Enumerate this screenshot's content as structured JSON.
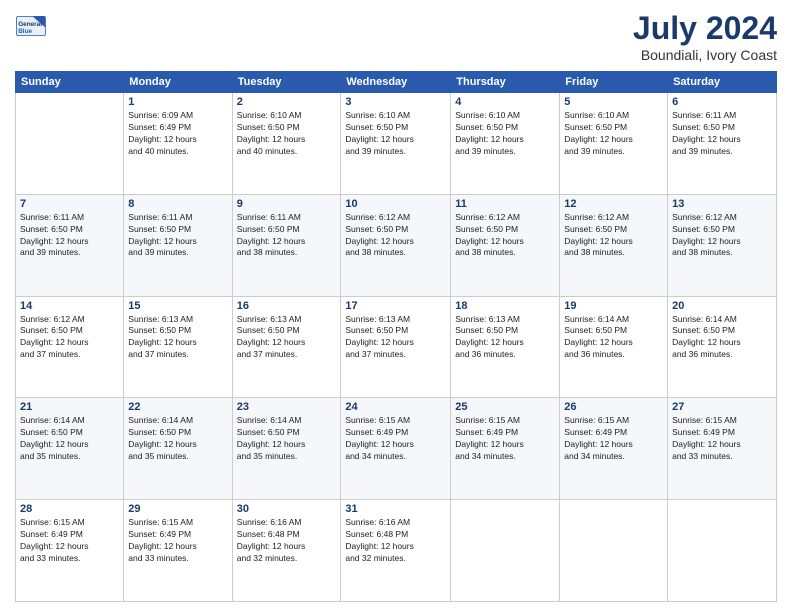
{
  "logo": {
    "line1": "General",
    "line2": "Blue"
  },
  "title": "July 2024",
  "subtitle": "Boundiali, Ivory Coast",
  "header_days": [
    "Sunday",
    "Monday",
    "Tuesday",
    "Wednesday",
    "Thursday",
    "Friday",
    "Saturday"
  ],
  "weeks": [
    [
      {
        "day": "",
        "info": ""
      },
      {
        "day": "1",
        "info": "Sunrise: 6:09 AM\nSunset: 6:49 PM\nDaylight: 12 hours\nand 40 minutes."
      },
      {
        "day": "2",
        "info": "Sunrise: 6:10 AM\nSunset: 6:50 PM\nDaylight: 12 hours\nand 40 minutes."
      },
      {
        "day": "3",
        "info": "Sunrise: 6:10 AM\nSunset: 6:50 PM\nDaylight: 12 hours\nand 39 minutes."
      },
      {
        "day": "4",
        "info": "Sunrise: 6:10 AM\nSunset: 6:50 PM\nDaylight: 12 hours\nand 39 minutes."
      },
      {
        "day": "5",
        "info": "Sunrise: 6:10 AM\nSunset: 6:50 PM\nDaylight: 12 hours\nand 39 minutes."
      },
      {
        "day": "6",
        "info": "Sunrise: 6:11 AM\nSunset: 6:50 PM\nDaylight: 12 hours\nand 39 minutes."
      }
    ],
    [
      {
        "day": "7",
        "info": "Sunrise: 6:11 AM\nSunset: 6:50 PM\nDaylight: 12 hours\nand 39 minutes."
      },
      {
        "day": "8",
        "info": "Sunrise: 6:11 AM\nSunset: 6:50 PM\nDaylight: 12 hours\nand 39 minutes."
      },
      {
        "day": "9",
        "info": "Sunrise: 6:11 AM\nSunset: 6:50 PM\nDaylight: 12 hours\nand 38 minutes."
      },
      {
        "day": "10",
        "info": "Sunrise: 6:12 AM\nSunset: 6:50 PM\nDaylight: 12 hours\nand 38 minutes."
      },
      {
        "day": "11",
        "info": "Sunrise: 6:12 AM\nSunset: 6:50 PM\nDaylight: 12 hours\nand 38 minutes."
      },
      {
        "day": "12",
        "info": "Sunrise: 6:12 AM\nSunset: 6:50 PM\nDaylight: 12 hours\nand 38 minutes."
      },
      {
        "day": "13",
        "info": "Sunrise: 6:12 AM\nSunset: 6:50 PM\nDaylight: 12 hours\nand 38 minutes."
      }
    ],
    [
      {
        "day": "14",
        "info": "Sunrise: 6:12 AM\nSunset: 6:50 PM\nDaylight: 12 hours\nand 37 minutes."
      },
      {
        "day": "15",
        "info": "Sunrise: 6:13 AM\nSunset: 6:50 PM\nDaylight: 12 hours\nand 37 minutes."
      },
      {
        "day": "16",
        "info": "Sunrise: 6:13 AM\nSunset: 6:50 PM\nDaylight: 12 hours\nand 37 minutes."
      },
      {
        "day": "17",
        "info": "Sunrise: 6:13 AM\nSunset: 6:50 PM\nDaylight: 12 hours\nand 37 minutes."
      },
      {
        "day": "18",
        "info": "Sunrise: 6:13 AM\nSunset: 6:50 PM\nDaylight: 12 hours\nand 36 minutes."
      },
      {
        "day": "19",
        "info": "Sunrise: 6:14 AM\nSunset: 6:50 PM\nDaylight: 12 hours\nand 36 minutes."
      },
      {
        "day": "20",
        "info": "Sunrise: 6:14 AM\nSunset: 6:50 PM\nDaylight: 12 hours\nand 36 minutes."
      }
    ],
    [
      {
        "day": "21",
        "info": "Sunrise: 6:14 AM\nSunset: 6:50 PM\nDaylight: 12 hours\nand 35 minutes."
      },
      {
        "day": "22",
        "info": "Sunrise: 6:14 AM\nSunset: 6:50 PM\nDaylight: 12 hours\nand 35 minutes."
      },
      {
        "day": "23",
        "info": "Sunrise: 6:14 AM\nSunset: 6:50 PM\nDaylight: 12 hours\nand 35 minutes."
      },
      {
        "day": "24",
        "info": "Sunrise: 6:15 AM\nSunset: 6:49 PM\nDaylight: 12 hours\nand 34 minutes."
      },
      {
        "day": "25",
        "info": "Sunrise: 6:15 AM\nSunset: 6:49 PM\nDaylight: 12 hours\nand 34 minutes."
      },
      {
        "day": "26",
        "info": "Sunrise: 6:15 AM\nSunset: 6:49 PM\nDaylight: 12 hours\nand 34 minutes."
      },
      {
        "day": "27",
        "info": "Sunrise: 6:15 AM\nSunset: 6:49 PM\nDaylight: 12 hours\nand 33 minutes."
      }
    ],
    [
      {
        "day": "28",
        "info": "Sunrise: 6:15 AM\nSunset: 6:49 PM\nDaylight: 12 hours\nand 33 minutes."
      },
      {
        "day": "29",
        "info": "Sunrise: 6:15 AM\nSunset: 6:49 PM\nDaylight: 12 hours\nand 33 minutes."
      },
      {
        "day": "30",
        "info": "Sunrise: 6:16 AM\nSunset: 6:48 PM\nDaylight: 12 hours\nand 32 minutes."
      },
      {
        "day": "31",
        "info": "Sunrise: 6:16 AM\nSunset: 6:48 PM\nDaylight: 12 hours\nand 32 minutes."
      },
      {
        "day": "",
        "info": ""
      },
      {
        "day": "",
        "info": ""
      },
      {
        "day": "",
        "info": ""
      }
    ]
  ]
}
